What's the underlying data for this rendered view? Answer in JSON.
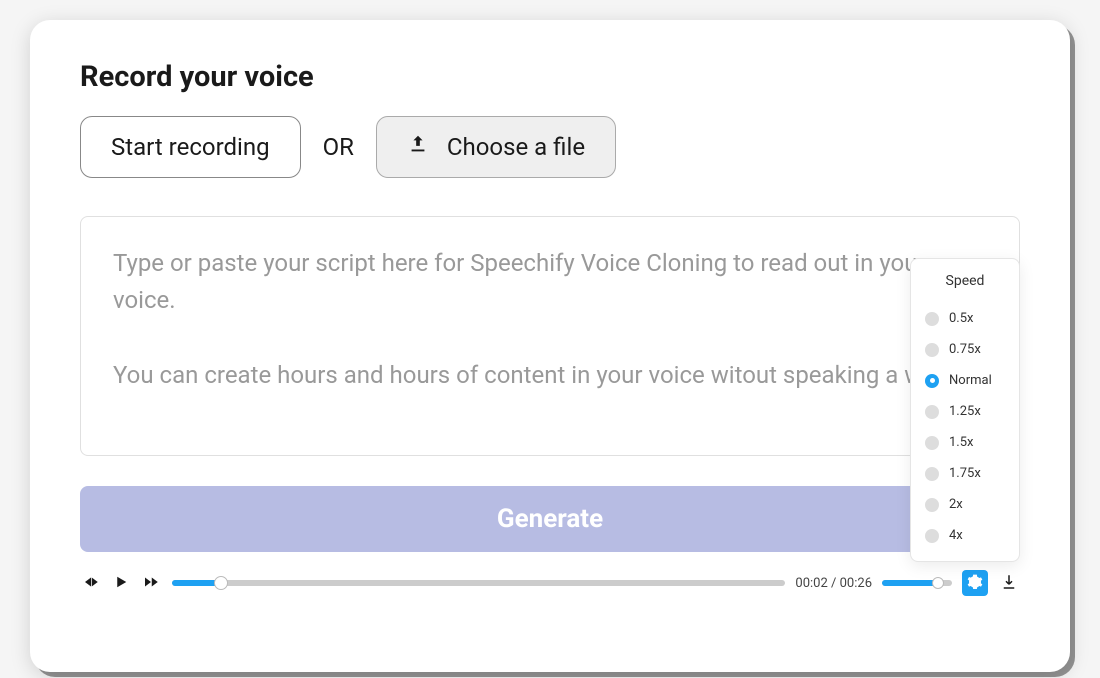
{
  "title": "Record your voice",
  "buttons": {
    "start_recording": "Start recording",
    "or": "OR",
    "choose_file": "Choose a file",
    "generate": "Generate"
  },
  "script": {
    "placeholder": "Type or paste your script here for Speechify Voice Cloning to read out in your own voice.\n\nYou can create hours and hours of content in your voice witout speaking a word."
  },
  "player": {
    "current_time": "00:02",
    "total_time": "00:26",
    "separator": " / "
  },
  "speed": {
    "title": "Speed",
    "options": [
      {
        "label": "0.5x",
        "selected": false
      },
      {
        "label": "0.75x",
        "selected": false
      },
      {
        "label": "Normal",
        "selected": true
      },
      {
        "label": "1.25x",
        "selected": false
      },
      {
        "label": "1.5x",
        "selected": false
      },
      {
        "label": "1.75x",
        "selected": false
      },
      {
        "label": "2x",
        "selected": false
      },
      {
        "label": "4x",
        "selected": false
      }
    ]
  }
}
